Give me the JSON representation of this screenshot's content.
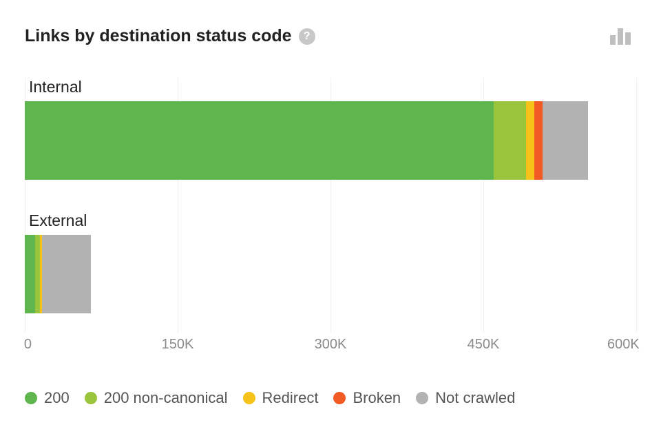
{
  "title": "Links by destination status code",
  "help_glyph": "?",
  "chart_data": {
    "type": "bar",
    "orientation": "horizontal",
    "stacked": true,
    "xlabel": "",
    "ylabel": "",
    "xlim": [
      0,
      600000
    ],
    "ticks": [
      0,
      150000,
      300000,
      450000,
      600000
    ],
    "tick_labels": [
      "0",
      "150K",
      "300K",
      "450K",
      "600K"
    ],
    "categories": [
      "Internal",
      "External"
    ],
    "series": [
      {
        "name": "200",
        "color": "#60b64e",
        "values": [
          460000,
          10000
        ]
      },
      {
        "name": "200 non-canonical",
        "color": "#9ac43c",
        "values": [
          32000,
          5000
        ]
      },
      {
        "name": "Redirect",
        "color": "#f6c418",
        "values": [
          8000,
          2000
        ]
      },
      {
        "name": "Broken",
        "color": "#f25a24",
        "values": [
          8000,
          0
        ]
      },
      {
        "name": "Not crawled",
        "color": "#b2b2b2",
        "values": [
          45000,
          48000
        ]
      }
    ]
  }
}
